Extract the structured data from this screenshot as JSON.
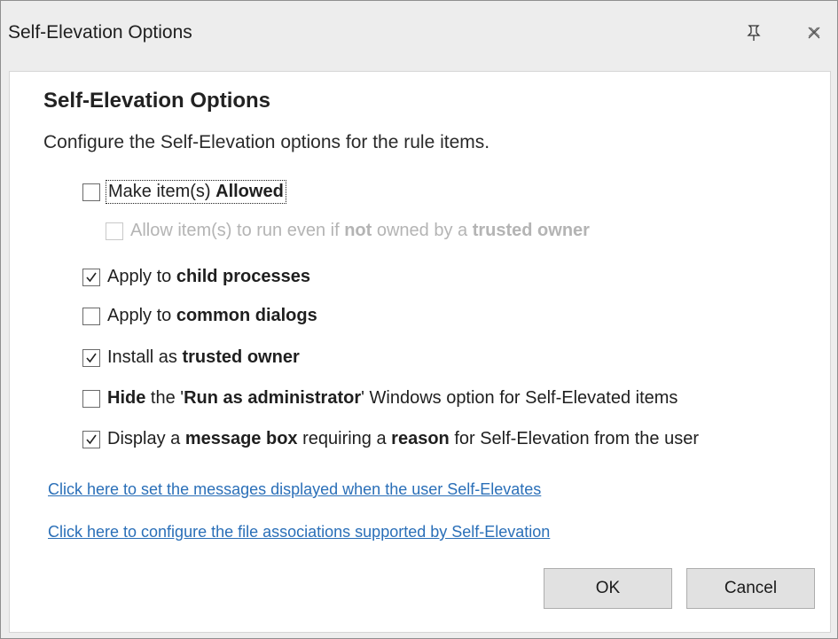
{
  "window": {
    "title": "Self-Elevation Options",
    "pin_icon": "pin-icon",
    "close_icon": "close-icon"
  },
  "content": {
    "heading": "Self-Elevation Options",
    "description": "Configure the Self-Elevation options for the rule items."
  },
  "options": [
    {
      "pre": "Make item(s) ",
      "bold1": "Allowed",
      "mid": "",
      "bold2": "",
      "post": "",
      "checked": false,
      "enabled": true
    },
    {
      "pre": "Allow item(s) to run even if ",
      "bold1": "not",
      "mid": " owned by a ",
      "bold2": "trusted owner",
      "post": "",
      "checked": false,
      "enabled": false
    },
    {
      "pre": "Apply to ",
      "bold1": "child processes",
      "mid": "",
      "bold2": "",
      "post": "",
      "checked": true,
      "enabled": true
    },
    {
      "pre": "Apply to ",
      "bold1": "common dialogs",
      "mid": "",
      "bold2": "",
      "post": "",
      "checked": false,
      "enabled": true
    },
    {
      "pre": "Install as ",
      "bold1": "trusted owner",
      "mid": "",
      "bold2": "",
      "post": "",
      "checked": true,
      "enabled": true
    },
    {
      "pre": "",
      "bold1": "Hide",
      "mid": " the '",
      "bold2": "Run as administrator",
      "post": "' Windows option for Self-Elevated items",
      "checked": false,
      "enabled": true
    },
    {
      "pre": "Display a ",
      "bold1": "message box",
      "mid": " requiring a ",
      "bold2": "reason",
      "post": " for Self-Elevation from the user",
      "checked": true,
      "enabled": true
    }
  ],
  "links": {
    "messages": "Click here to set the messages displayed when the user Self-Elevates",
    "associations": "Click here to configure the file associations supported by Self-Elevation"
  },
  "buttons": {
    "ok": "OK",
    "cancel": "Cancel"
  }
}
